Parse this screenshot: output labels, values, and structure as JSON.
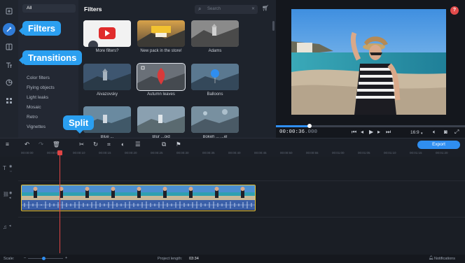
{
  "rail": {
    "icons": [
      "import-icon",
      "filters-icon",
      "transitions-icon",
      "titles-icon",
      "stickers-icon",
      "more-icon"
    ]
  },
  "categories": {
    "all": "All",
    "items": [
      "Color filters",
      "Flying objects",
      "Light leaks",
      "Mosaic",
      "Retro",
      "Vignettes"
    ]
  },
  "panel": {
    "title": "Filters",
    "search_placeholder": "Search",
    "thumbs": [
      {
        "caption": "More filters?"
      },
      {
        "caption": "New pack in the store!"
      },
      {
        "caption": "Adams"
      },
      {
        "caption": "Aivazovsky"
      },
      {
        "caption": "Autumn leaves"
      },
      {
        "caption": "Balloons"
      },
      {
        "caption": "Blue ..."
      },
      {
        "caption": "Blur ...oid"
      },
      {
        "caption": "Bokeh ... ...el"
      }
    ]
  },
  "preview": {
    "timecode_main": "00:00:36",
    "timecode_ms": ".000",
    "aspect": "16:9",
    "notifications_badge": "?"
  },
  "toolbar": {
    "export_label": "Export"
  },
  "ruler": {
    "ticks": [
      "00:00:00",
      "00:00:05",
      "00:00:10",
      "00:00:15",
      "00:00:20",
      "00:00:25",
      "00:00:30",
      "00:00:35",
      "00:00:40",
      "00:00:45",
      "00:00:50",
      "00:00:55",
      "00:01:00",
      "00:01:05",
      "00:01:10",
      "00:01:15",
      "00:01:20",
      "00:01:25"
    ]
  },
  "status": {
    "scale_label": "Scale:",
    "project_length_label": "Project length:",
    "project_length": "03:34",
    "notifications_label": "Notifications"
  },
  "callouts": {
    "filters": "Filters",
    "transitions": "Transitions",
    "split": "Split"
  },
  "colors": {
    "accent": "#2f8ef0",
    "callout": "#2b9ff0",
    "clip_border": "#e8c638",
    "playhead": "#e04545"
  }
}
